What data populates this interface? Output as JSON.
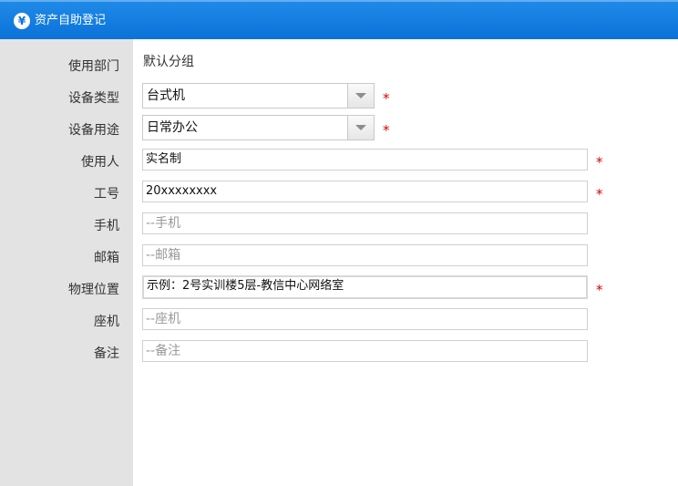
{
  "window": {
    "title": "资产自助登记",
    "icon": "yen-icon"
  },
  "form": {
    "department": {
      "label": "使用部门",
      "value": "默认分组"
    },
    "device_type": {
      "label": "设备类型",
      "value": "台式机",
      "required_mark": "*"
    },
    "device_usage": {
      "label": "设备用途",
      "value": "日常办公",
      "required_mark": "*"
    },
    "user": {
      "label": "使用人",
      "value": "实名制",
      "required_mark": "*"
    },
    "employee_id": {
      "label": "工号",
      "value": "20xxxxxxxx",
      "required_mark": "*"
    },
    "phone": {
      "label": "手机",
      "placeholder": "--手机"
    },
    "email": {
      "label": "邮箱",
      "placeholder": "--邮箱"
    },
    "location": {
      "label": "物理位置",
      "value": "示例：2号实训楼5层-教信中心网络室",
      "required_mark": "*"
    },
    "landline": {
      "label": "座机",
      "placeholder": "--座机"
    },
    "notes": {
      "label": "备注",
      "placeholder": "--备注"
    }
  },
  "colors": {
    "titlebar": "#0b72d8",
    "sidebar": "#e3e3e3",
    "required": "#e00000"
  }
}
